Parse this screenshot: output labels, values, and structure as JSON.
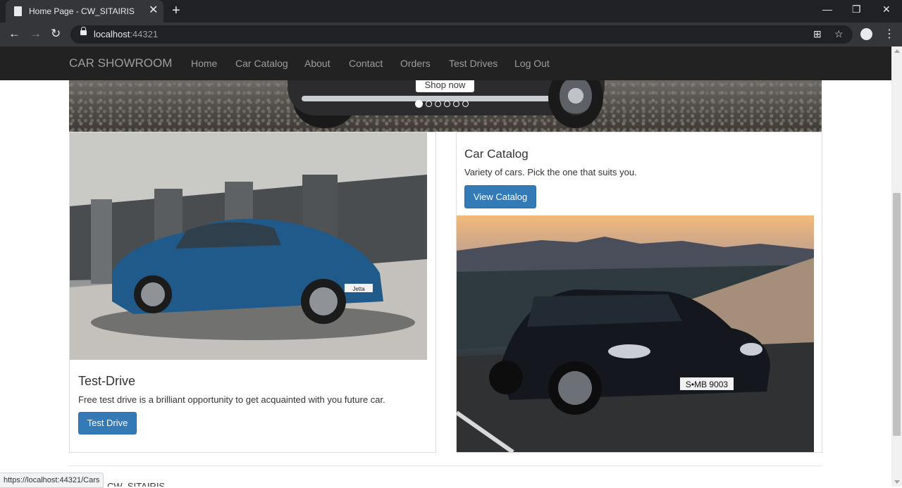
{
  "browser": {
    "tab_title": "Home Page - CW_SITAIRIS",
    "url_host": "localhost",
    "url_port": ":44321",
    "status_url": "https://localhost:44321/Cars"
  },
  "navbar": {
    "brand": "CAR SHOWROOM",
    "links": [
      "Home",
      "Car Catalog",
      "About",
      "Contact",
      "Orders",
      "Test Drives",
      "Log Out"
    ]
  },
  "carousel": {
    "button": "Shop now",
    "indicator_count": 6,
    "active_index": 0
  },
  "test_drive": {
    "title": "Test-Drive",
    "text": "Free test drive is a brilliant opportunity to get acquainted with you future car.",
    "button": "Test Drive"
  },
  "catalog": {
    "title": "Car Catalog",
    "text": "Variety of cars. Pick the one that suits you.",
    "button": "View Catalog"
  },
  "footer": {
    "text": "CW_SITAIRIS"
  },
  "images": {
    "jetta_badge": "Jetta",
    "merc_plate": "S•MB 9003"
  }
}
